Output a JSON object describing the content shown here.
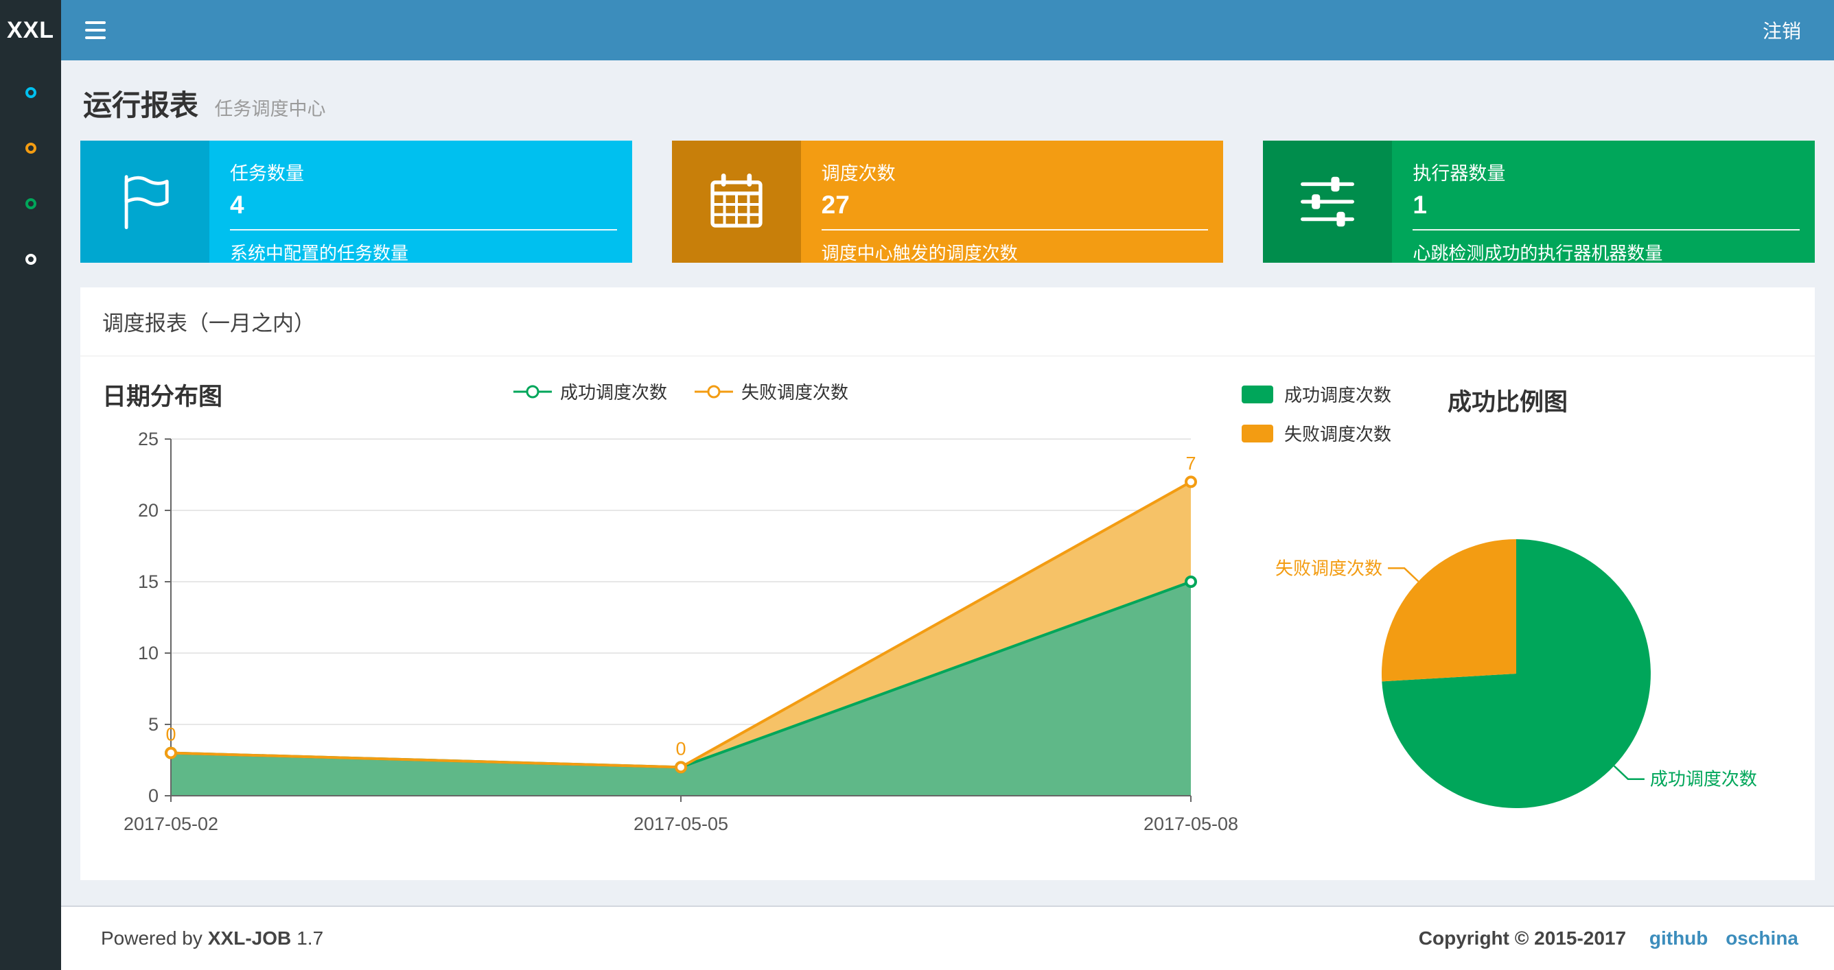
{
  "header": {
    "logo": "XXL",
    "logout_label": "注销"
  },
  "sidebar": {
    "items": [
      {
        "name": "menu-dot-1",
        "color": "#00c0ef"
      },
      {
        "name": "menu-dot-2",
        "color": "#f39c12"
      },
      {
        "name": "menu-dot-3",
        "color": "#00a65a"
      },
      {
        "name": "menu-dot-4",
        "color": "#ffffff"
      }
    ]
  },
  "page": {
    "title": "运行报表",
    "subtitle": "任务调度中心"
  },
  "info_boxes": [
    {
      "label": "任务数量",
      "value": "4",
      "caption": "系统中配置的任务数量",
      "bg": "#00c0ef",
      "icon_bg": "#00a7d0",
      "icon": "flag-icon"
    },
    {
      "label": "调度次数",
      "value": "27",
      "caption": "调度中心触发的调度次数",
      "bg": "#f39c12",
      "icon_bg": "#c87f0a",
      "icon": "calendar-icon"
    },
    {
      "label": "执行器数量",
      "value": "1",
      "caption": "心跳检测成功的执行器机器数量",
      "bg": "#00a65a",
      "icon_bg": "#008d4c",
      "icon": "sliders-icon"
    }
  ],
  "panel": {
    "title": "调度报表（一月之内）"
  },
  "chart_data": [
    {
      "type": "area",
      "title": "日期分布图",
      "stacked": true,
      "x": [
        "2017-05-02",
        "2017-05-05",
        "2017-05-08"
      ],
      "series": [
        {
          "name": "成功调度次数",
          "color": "#00a65a",
          "area_color": "#5fb888",
          "values": [
            3,
            2,
            15
          ]
        },
        {
          "name": "失败调度次数",
          "color": "#f39c12",
          "area_color": "#f6c267",
          "values": [
            0,
            0,
            7
          ],
          "labels": [
            "0",
            "0",
            "7"
          ]
        }
      ],
      "ylim": [
        0,
        25
      ],
      "yticks": [
        0,
        5,
        10,
        15,
        20,
        25
      ],
      "legend_position": "top-center",
      "grid": true
    },
    {
      "type": "pie",
      "title": "成功比例图",
      "slices": [
        {
          "name": "成功调度次数",
          "value": 20,
          "color": "#00a65a"
        },
        {
          "name": "失败调度次数",
          "value": 7,
          "color": "#f39c12"
        }
      ],
      "legend_position": "top-left"
    }
  ],
  "footer": {
    "powered_prefix": "Powered by",
    "product": "XXL-JOB",
    "version": "1.7",
    "copyright": "Copyright © 2015-2017",
    "links": [
      {
        "label": "github"
      },
      {
        "label": "oschina"
      }
    ]
  }
}
